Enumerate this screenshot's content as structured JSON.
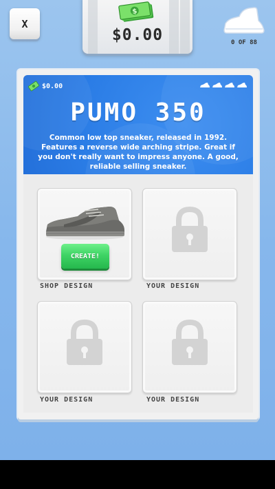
{
  "top_bar": {
    "close_label": "X",
    "balance": "$0.00",
    "collection_count": "0 OF 88"
  },
  "product": {
    "balance": "$0.00",
    "name": "PUMO 350",
    "description": "Common low top sneaker, released in 1992. Features a reverse wide arching stripe. Great if you don't really want to impress anyone. A good, reliable selling sneaker.",
    "rarity_shoes": 4,
    "rarity_icon": "sneaker-icon"
  },
  "designs": [
    {
      "label": "SHOP DESIGN",
      "locked": false,
      "action_label": "CREATE!",
      "image": "sneaker-image"
    },
    {
      "label": "YOUR DESIGN",
      "locked": true,
      "icon": "lock-icon"
    },
    {
      "label": "YOUR DESIGN",
      "locked": true,
      "icon": "lock-icon"
    },
    {
      "label": "YOUR DESIGN",
      "locked": true,
      "icon": "lock-icon"
    }
  ],
  "colors": {
    "background": "#86b7ec",
    "header_blue": "#2b7de6",
    "create_green": "#3fd465",
    "lock_gray": "#d3d3d3"
  }
}
